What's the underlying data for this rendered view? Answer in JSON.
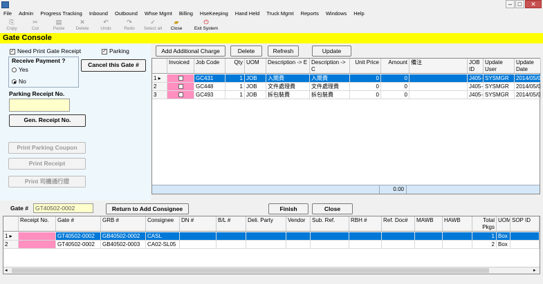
{
  "menu": [
    "File",
    "Admin",
    "Progress Tracking",
    "Inbound",
    "Outbound",
    "Whse Mgmt",
    "Billing",
    "HseKeeping",
    "Hand Held",
    "Truck Mgmt",
    "Reports",
    "Windows",
    "Help"
  ],
  "toolbar": [
    {
      "label": "Copy",
      "icon": "copy-icon",
      "enabled": false
    },
    {
      "label": "Cut",
      "icon": "cut-icon",
      "enabled": false
    },
    {
      "label": "Paste",
      "icon": "paste-icon",
      "enabled": false
    },
    {
      "label": "Delete",
      "icon": "delete-icon",
      "enabled": false
    },
    {
      "label": "Undo",
      "icon": "undo-icon",
      "enabled": false
    },
    {
      "label": "Redo",
      "icon": "redo-icon",
      "enabled": false
    },
    {
      "label": "Select all",
      "icon": "select-all-icon",
      "enabled": false
    },
    {
      "label": "Close",
      "icon": "close-folder-icon",
      "enabled": true
    },
    {
      "label": "Exit System",
      "icon": "exit-icon",
      "enabled": true
    }
  ],
  "header": {
    "title": "Gate Console"
  },
  "left": {
    "need_print_label": "Need Print Gate Receipt",
    "parking_label": "Parking",
    "receive_payment_label": "Receive Payment ?",
    "yes_label": "Yes",
    "no_label": "No",
    "cancel_gate_label": "Cancel this Gate #",
    "parking_receipt_label": "Parking Receipt No.",
    "gen_receipt_label": "Gen. Receipt No.",
    "print_parking_coupon_label": "Print Parking Coupon",
    "print_receipt_label": "Print Receipt",
    "print_pass_label": "Print 司機通行證"
  },
  "actions": {
    "add_charge": "Add Additional Charge",
    "delete": "Delete",
    "refresh": "Refresh",
    "update": "Update"
  },
  "charges": {
    "columns": [
      "Invoiced",
      "Job Code",
      "Qty",
      "UOM",
      "Description -> E",
      "Description -> C",
      "Unit Price",
      "Amount",
      "備注",
      "JOB ID",
      "Update User",
      "Update Date"
    ],
    "rows": [
      {
        "num": "1",
        "job_code": "GC431",
        "qty": "1",
        "uom": "JOB",
        "desc_e": "入閘費",
        "desc_c": "入閘費",
        "unit_price": "0",
        "amount": "0",
        "remark": "",
        "job_id": "J405-",
        "user": "SYSMGR",
        "date": "2014/05/0"
      },
      {
        "num": "2",
        "job_code": "GC448",
        "qty": "1",
        "uom": "JOB",
        "desc_e": "文件處理費",
        "desc_c": "文件處理費",
        "unit_price": "0",
        "amount": "0",
        "remark": "",
        "job_id": "J405-",
        "user": "SYSMGR",
        "date": "2014/05/0"
      },
      {
        "num": "3",
        "job_code": "GC493",
        "qty": "1",
        "uom": "JOB",
        "desc_e": "拆包裝費",
        "desc_c": "拆包裝費",
        "unit_price": "0",
        "amount": "0",
        "remark": "",
        "job_id": "J405-",
        "user": "SYSMGR",
        "date": "2014/05/0"
      }
    ],
    "total": "0.00"
  },
  "gate": {
    "label": "Gate #",
    "value": "GT40502-0002",
    "return_label": "Return to Add Consignee",
    "finish_label": "Finish",
    "close_label": "Close"
  },
  "consignees": {
    "columns": [
      "Receipt No.",
      "Gate #",
      "GRB #",
      "Consignee",
      "DN #",
      "B/L #",
      "Deli. Party",
      "Vendor",
      "Sub. Ref.",
      "RBH #",
      "Ref. Doc#",
      "MAWB",
      "HAWB",
      "Total Pkgs",
      "UOM",
      "SOP ID"
    ],
    "rows": [
      {
        "num": "1",
        "receipt": "",
        "gate": "GT40502-0002",
        "grb": "GB40502-0002",
        "consignee": "CASL",
        "pkgs": "1",
        "uom": "Box"
      },
      {
        "num": "2",
        "receipt": "",
        "gate": "GT40502-0002",
        "grb": "GB40502-0003",
        "consignee": "CA02-SL05",
        "pkgs": "2",
        "uom": "Box"
      }
    ]
  }
}
